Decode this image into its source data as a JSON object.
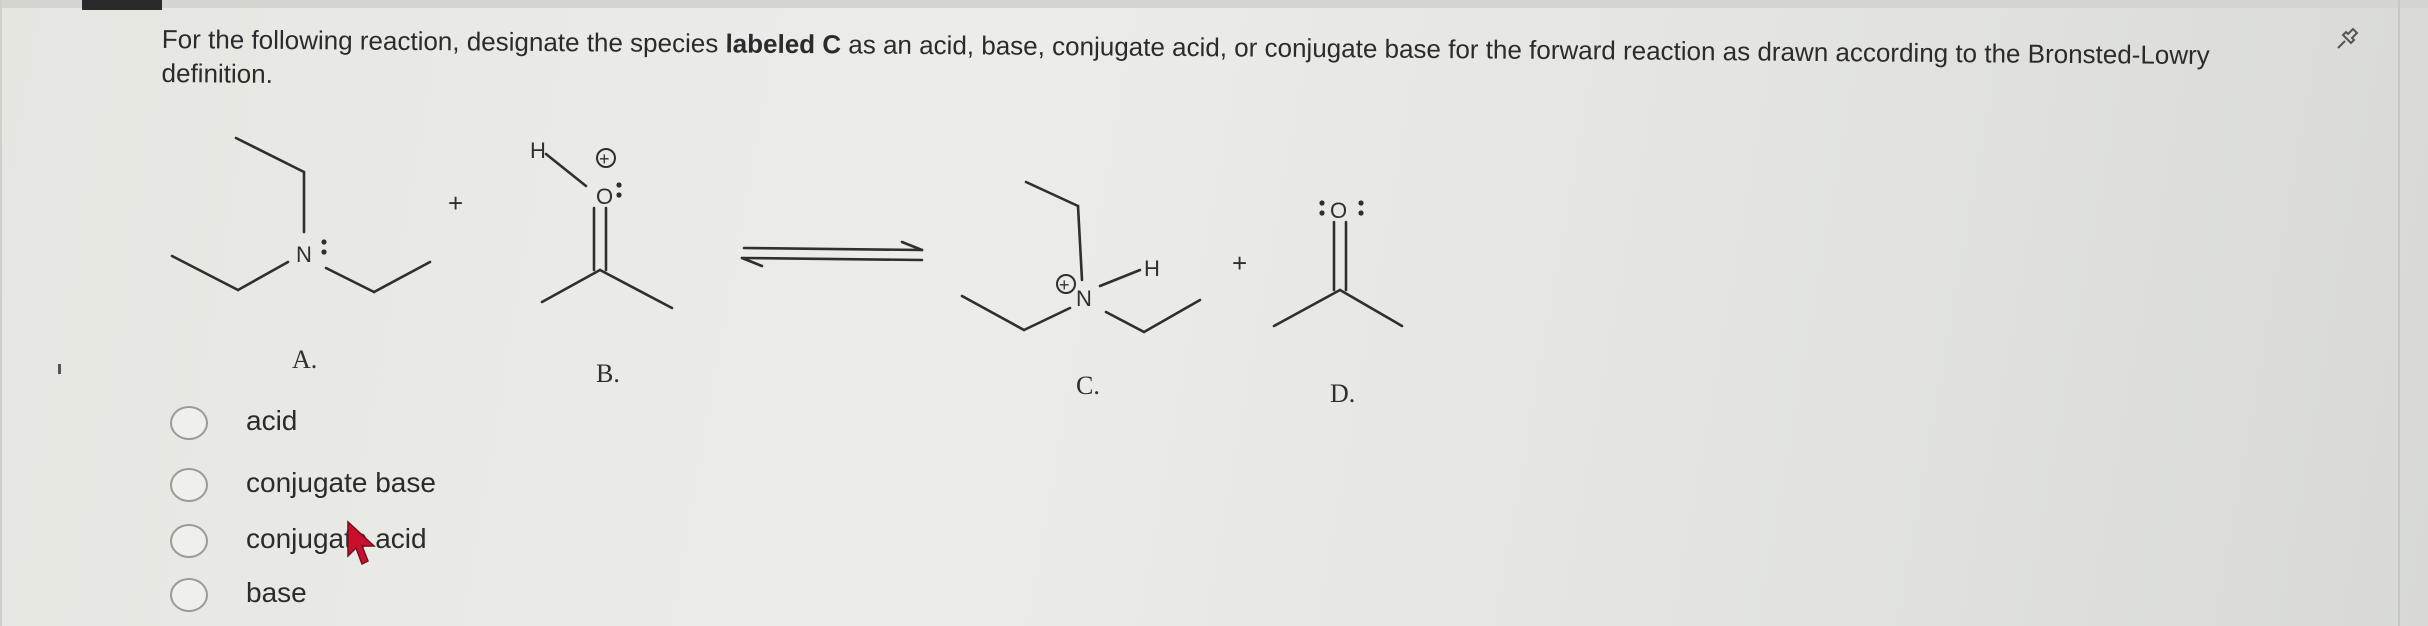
{
  "question": {
    "part1": "For the following reaction, designate the species labeled ",
    "bold": "labeled C",
    "bold_letter": "C",
    "part2": " as an acid, base, conjugate acid, or conjugate base for the forward reaction as drawn according to the Bronsted-Lowry",
    "part3": "definition."
  },
  "species_labels": {
    "a": "A.",
    "b": "B.",
    "c": "C.",
    "d": "D."
  },
  "atoms": {
    "n": "N",
    "o": "O",
    "h": "H",
    "charge": "+",
    "lone_pair": ":"
  },
  "plus_sign": "+",
  "choices": [
    {
      "label": "acid"
    },
    {
      "label": "conjugate base"
    },
    {
      "label": "conjugate acid",
      "visible_text": "conjuga acid"
    },
    {
      "label": "base"
    }
  ],
  "icons": {
    "pin": "pin-icon",
    "cursor": "mouse-pointer-icon"
  },
  "colors": {
    "text": "#2b2b2b",
    "cursor": "#c8102e",
    "radio_border": "#9a9a97"
  }
}
